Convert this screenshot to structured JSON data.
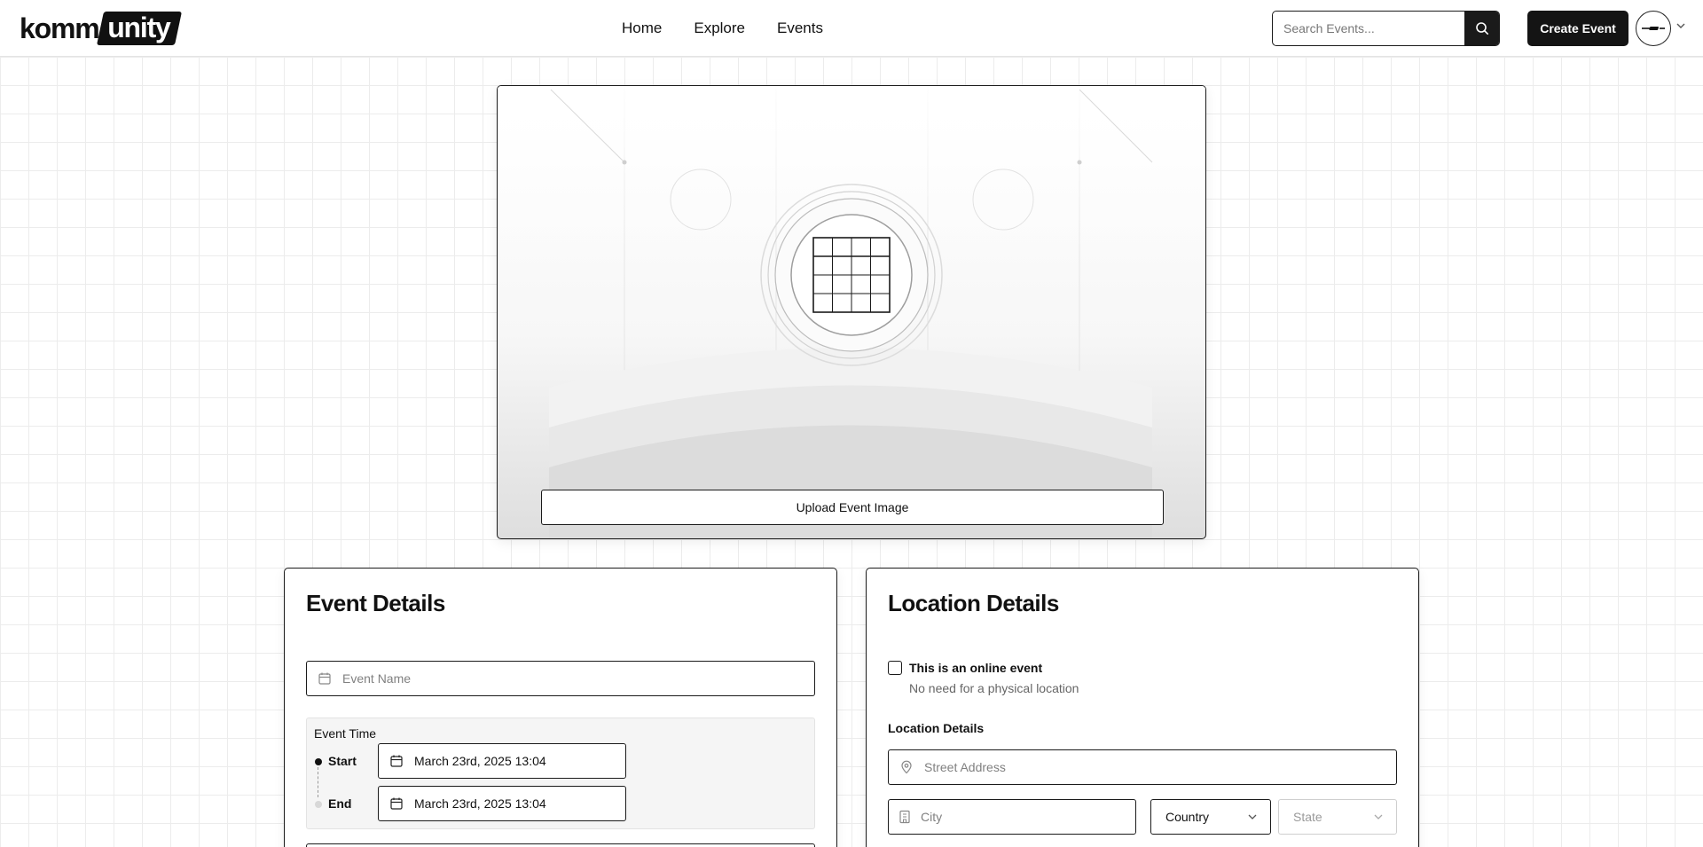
{
  "header": {
    "logo": {
      "part1": "komm",
      "part2": "unity"
    },
    "nav": [
      "Home",
      "Explore",
      "Events"
    ],
    "search": {
      "placeholder": "Search Events...",
      "value": ""
    },
    "create_button": "Create Event",
    "icons": {
      "search": "search-icon",
      "avatar": "user-avatar",
      "caret": "chevron-down-icon"
    }
  },
  "banner": {
    "upload_button": "Upload Event Image",
    "icon": "calendar-grid-icon"
  },
  "event_details": {
    "title": "Event Details",
    "event_name": {
      "placeholder": "Event Name",
      "value": "",
      "icon": "calendar-icon"
    },
    "time": {
      "title": "Event Time",
      "start_label": "Start",
      "start_value": "March 23rd, 2025 13:04",
      "end_label": "End",
      "end_value": "March 23rd, 2025 13:04"
    }
  },
  "location_details": {
    "title": "Location Details",
    "online_checkbox": {
      "label": "This is an online event",
      "subtext": "No need for a physical location",
      "checked": false
    },
    "section_label": "Location Details",
    "street": {
      "placeholder": "Street Address",
      "value": "",
      "icon": "map-pin-icon"
    },
    "city": {
      "placeholder": "City",
      "value": "",
      "icon": "building-icon"
    },
    "country": {
      "value": "Country"
    },
    "state": {
      "value": "State",
      "disabled": true
    }
  },
  "colors": {
    "primary": "#141414",
    "grid": "#ececec",
    "muted": "#808080"
  }
}
